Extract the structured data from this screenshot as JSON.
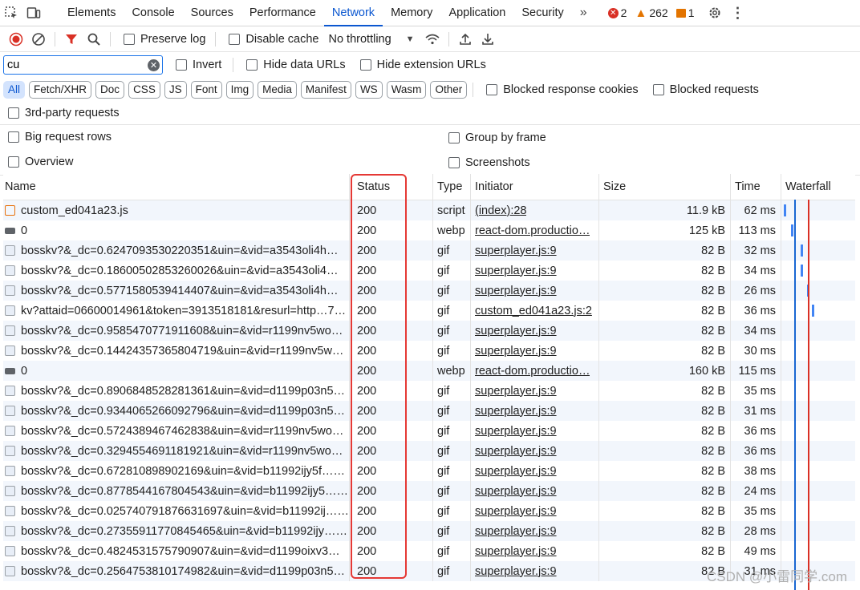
{
  "tabs": [
    "Elements",
    "Console",
    "Sources",
    "Performance",
    "Network",
    "Memory",
    "Application",
    "Security"
  ],
  "active_tab": "Network",
  "issues": {
    "errors": "2",
    "warnings": "262",
    "info": "1"
  },
  "toolbar": {
    "preserve_log": "Preserve log",
    "disable_cache": "Disable cache",
    "throttling": "No throttling"
  },
  "filter": {
    "value": "cu",
    "invert": "Invert",
    "hide_data": "Hide data URLs",
    "hide_ext": "Hide extension URLs"
  },
  "types": [
    "All",
    "Fetch/XHR",
    "Doc",
    "CSS",
    "JS",
    "Font",
    "Img",
    "Media",
    "Manifest",
    "WS",
    "Wasm",
    "Other"
  ],
  "blocked_cookies": "Blocked response cookies",
  "blocked_requests": "Blocked requests",
  "third_party": "3rd-party requests",
  "settings": {
    "big_rows": "Big request rows",
    "group_frame": "Group by frame",
    "overview": "Overview",
    "screenshots": "Screenshots"
  },
  "columns": {
    "name": "Name",
    "status": "Status",
    "type": "Type",
    "initiator": "Initiator",
    "size": "Size",
    "time": "Time",
    "waterfall": "Waterfall"
  },
  "colors": {
    "accent": "#0b57d0",
    "error": "#d93025",
    "warning": "#e37400",
    "highlight": "#e53935"
  },
  "rows": [
    {
      "name": "custom_ed041a23.js",
      "icon": "script",
      "status": "200",
      "type": "script",
      "initiator": "(index):28",
      "size": "11.9 kB",
      "time": "62 ms"
    },
    {
      "name": "0",
      "icon": "webp",
      "status": "200",
      "type": "webp",
      "initiator": "react-dom.productio…",
      "size": "125 kB",
      "time": "113 ms"
    },
    {
      "name": "bosskv?&_dc=0.6247093530220351&uin=&vid=a3543oli4h……",
      "icon": "gif",
      "status": "200",
      "type": "gif",
      "initiator": "superplayer.js:9",
      "size": "82 B",
      "time": "32 ms"
    },
    {
      "name": "bosskv?&_dc=0.18600502853260026&uin=&vid=a3543oli4……",
      "icon": "gif",
      "status": "200",
      "type": "gif",
      "initiator": "superplayer.js:9",
      "size": "82 B",
      "time": "34 ms"
    },
    {
      "name": "bosskv?&_dc=0.5771580539414407&uin=&vid=a3543oli4h……",
      "icon": "gif",
      "status": "200",
      "type": "gif",
      "initiator": "superplayer.js:9",
      "size": "82 B",
      "time": "26 ms"
    },
    {
      "name": "kv?attaid=06600014961&token=3913518181&resurl=http…7…",
      "icon": "gif",
      "status": "200",
      "type": "gif",
      "initiator": "custom_ed041a23.js:2",
      "size": "82 B",
      "time": "36 ms"
    },
    {
      "name": "bosskv?&_dc=0.9585470771911608&uin=&vid=r1199nv5wo…",
      "icon": "gif",
      "status": "200",
      "type": "gif",
      "initiator": "superplayer.js:9",
      "size": "82 B",
      "time": "34 ms"
    },
    {
      "name": "bosskv?&_dc=0.1442435736580471​9&uin=&vid=r1199nv5w…",
      "icon": "gif",
      "status": "200",
      "type": "gif",
      "initiator": "superplayer.js:9",
      "size": "82 B",
      "time": "30 ms"
    },
    {
      "name": "0",
      "icon": "webp",
      "status": "200",
      "type": "webp",
      "initiator": "react-dom.productio…",
      "size": "160 kB",
      "time": "115 ms"
    },
    {
      "name": "bosskv?&_dc=0.8906848528281361&uin=&vid=d1199p03n5…",
      "icon": "gif",
      "status": "200",
      "type": "gif",
      "initiator": "superplayer.js:9",
      "size": "82 B",
      "time": "35 ms"
    },
    {
      "name": "bosskv?&_dc=0.9344065266092796&uin=&vid=d1199p03n5…",
      "icon": "gif",
      "status": "200",
      "type": "gif",
      "initiator": "superplayer.js:9",
      "size": "82 B",
      "time": "31 ms"
    },
    {
      "name": "bosskv?&_dc=0.5724389467462838&uin=&vid=r1199nv5wo…",
      "icon": "gif",
      "status": "200",
      "type": "gif",
      "initiator": "superplayer.js:9",
      "size": "82 B",
      "time": "36 ms"
    },
    {
      "name": "bosskv?&_dc=0.3294554691181921&uin=&vid=r1199nv5wo…",
      "icon": "gif",
      "status": "200",
      "type": "gif",
      "initiator": "superplayer.js:9",
      "size": "82 B",
      "time": "36 ms"
    },
    {
      "name": "bosskv?&_dc=0.672810898902169&uin=&vid=b11992ijy5f……",
      "icon": "gif",
      "status": "200",
      "type": "gif",
      "initiator": "superplayer.js:9",
      "size": "82 B",
      "time": "38 ms"
    },
    {
      "name": "bosskv?&_dc=0.8778544167804543&uin=&vid=b11992ijy5……",
      "icon": "gif",
      "status": "200",
      "type": "gif",
      "initiator": "superplayer.js:9",
      "size": "82 B",
      "time": "24 ms"
    },
    {
      "name": "bosskv?&_dc=0.025740791876631697&uin=&vid=b11992ij……",
      "icon": "gif",
      "status": "200",
      "type": "gif",
      "initiator": "superplayer.js:9",
      "size": "82 B",
      "time": "35 ms"
    },
    {
      "name": "bosskv?&_dc=0.27355911770845465&uin=&vid=b11992ijy……",
      "icon": "gif",
      "status": "200",
      "type": "gif",
      "initiator": "superplayer.js:9",
      "size": "82 B",
      "time": "28 ms"
    },
    {
      "name": "bosskv?&_dc=0.4824531575790907&uin=&vid=d1199oixv3…",
      "icon": "gif",
      "status": "200",
      "type": "gif",
      "initiator": "superplayer.js:9",
      "size": "82 B",
      "time": "49 ms"
    },
    {
      "name": "bosskv?&_dc=0.2564753810174982&uin=&vid=d1199p03n5…",
      "icon": "gif",
      "status": "200",
      "type": "gif",
      "initiator": "superplayer.js:9",
      "size": "82 B",
      "time": "31 ms"
    }
  ],
  "watermark": "CSDN @小雷同学.com"
}
